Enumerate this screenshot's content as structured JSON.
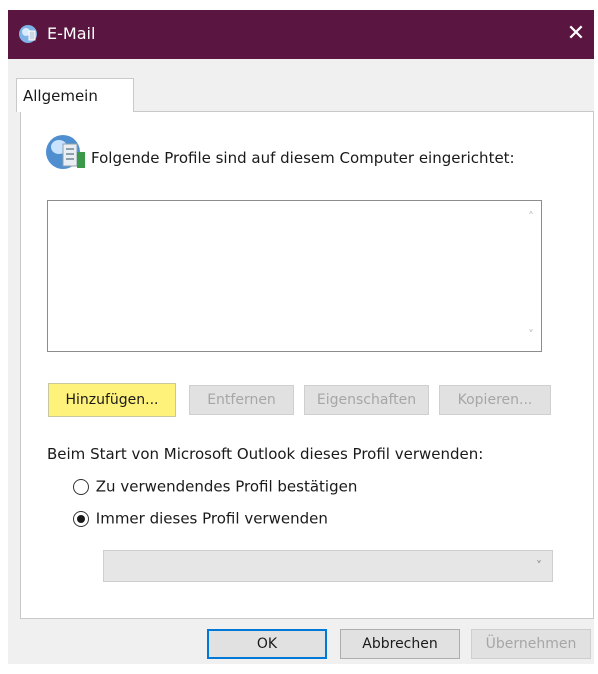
{
  "window": {
    "title": "E-Mail",
    "close_glyph": "✕",
    "titlebar_color": "#5a1640"
  },
  "tab": {
    "label": "Allgemein"
  },
  "profiles": {
    "intro": "Folgende Profile sind auf diesem Computer eingerichtet:",
    "items": []
  },
  "buttons": {
    "add": "Hinzufügen...",
    "remove": "Entfernen",
    "properties": "Eigenschaften",
    "copy": "Kopieren..."
  },
  "startup": {
    "label": "Beim Start von Microsoft Outlook dieses Profil verwenden:",
    "option_confirm": "Zu verwendendes Profil bestätigen",
    "option_always": "Immer dieses Profil verwenden",
    "selected": "option_always",
    "profile_select_value": ""
  },
  "footer": {
    "ok": "OK",
    "cancel": "Abbrechen",
    "apply": "Übernehmen"
  },
  "colors": {
    "highlight": "#fff27a",
    "focus": "#0078d7"
  }
}
